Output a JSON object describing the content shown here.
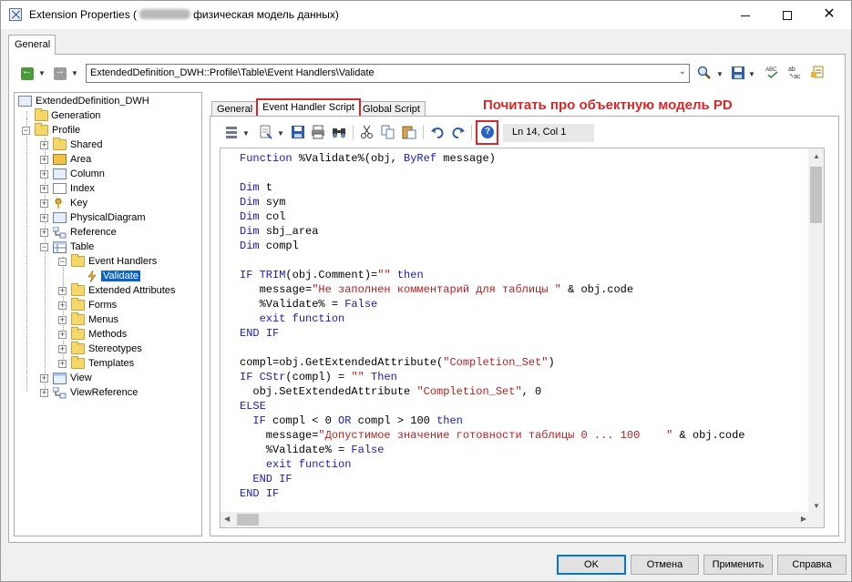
{
  "window": {
    "title_prefix": "Extension Properties (",
    "title_suffix": "физическая модель данных)",
    "minimize": "—",
    "maximize": "□",
    "close": "✕"
  },
  "outer_tabs": [
    {
      "label": "General"
    }
  ],
  "path_combo": {
    "value": "ExtendedDefinition_DWH::Profile\\Table\\Event Handlers\\Validate"
  },
  "tree": {
    "root": "ExtendedDefinition_DWH",
    "items": [
      {
        "label": "Generation"
      },
      {
        "label": "Profile"
      },
      {
        "label": "Shared"
      },
      {
        "label": "Area"
      },
      {
        "label": "Column"
      },
      {
        "label": "Index"
      },
      {
        "label": "Key"
      },
      {
        "label": "PhysicalDiagram"
      },
      {
        "label": "Reference"
      },
      {
        "label": "Table"
      },
      {
        "label": "Event Handlers"
      },
      {
        "label": "Validate"
      },
      {
        "label": "Extended Attributes"
      },
      {
        "label": "Forms"
      },
      {
        "label": "Menus"
      },
      {
        "label": "Methods"
      },
      {
        "label": "Stereotypes"
      },
      {
        "label": "Templates"
      },
      {
        "label": "View"
      },
      {
        "label": "ViewReference"
      }
    ]
  },
  "inner_tabs": [
    {
      "label": "General"
    },
    {
      "label": "Event Handler Script"
    },
    {
      "label": "Global Script"
    }
  ],
  "annotation": "Почитать про объектную модель PD",
  "help_icon": "help-icon",
  "cursor_position": "Ln 14, Col 1",
  "code_lines": [
    "Function %Validate%(obj, ByRef message)",
    "",
    "Dim t",
    "Dim sym",
    "Dim col",
    "Dim sbj_area",
    "Dim compl",
    "",
    "IF TRIM(obj.Comment)=\"\" then",
    "   message=\"Не заполнен комментарий для таблицы \" & obj.code",
    "   %Validate% = False",
    "   exit function",
    "END IF",
    "",
    "compl=obj.GetExtendedAttribute(\"Completion_Set\")",
    "IF CStr(compl) = \"\" Then",
    "  obj.SetExtendedAttribute \"Completion_Set\", 0",
    "ELSE",
    "  IF compl < 0 OR compl > 100 then",
    "    message=\"Допустимое значение готовности таблицы 0 ... 100    \" & obj.code",
    "    %Validate% = False",
    "    exit function",
    "  END IF",
    "END IF"
  ],
  "buttons": {
    "ok": "OK",
    "cancel": "Отмена",
    "apply": "Применить",
    "help": "Справка"
  },
  "colors": {
    "keyword": "#1b1bb6",
    "string": "#b81d1d",
    "highlight_red": "#d62828",
    "selection": "#0a64c8"
  }
}
